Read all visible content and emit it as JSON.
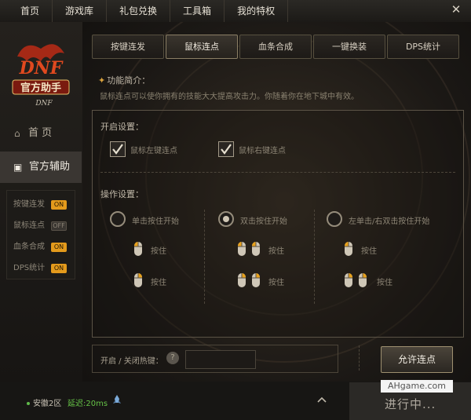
{
  "topnav": {
    "items": [
      {
        "label": "首页"
      },
      {
        "label": "游戏库"
      },
      {
        "label": "礼包兑换"
      },
      {
        "label": "工具箱"
      },
      {
        "label": "我的特权"
      }
    ],
    "close_icon": "close-icon"
  },
  "sidebar": {
    "logo_text": "官方助手",
    "logo_sub": "DNF",
    "home_label": "首 页",
    "official_label": "官方辅助",
    "subitems": [
      {
        "label": "按键连发",
        "state": "ON"
      },
      {
        "label": "鼠标连点",
        "state": "OFF"
      },
      {
        "label": "血条合成",
        "state": "ON"
      },
      {
        "label": "DPS统计",
        "state": "ON"
      }
    ]
  },
  "tabs": [
    {
      "label": "按键连发"
    },
    {
      "label": "鼠标连点"
    },
    {
      "label": "血条合成"
    },
    {
      "label": "一键换装"
    },
    {
      "label": "DPS统计"
    }
  ],
  "active_tab": "鼠标连点",
  "intro": {
    "title": "功能简介：",
    "text": "鼠标连点可以使你拥有的技能大大提高攻击力。你随着你在地下城中有效。"
  },
  "settings": {
    "open_label": "开启设置：",
    "left_click_label": "鼠标左键连点",
    "right_click_label": "鼠标右键连点",
    "left_checked": true,
    "right_checked": true,
    "op_label": "操作设置：",
    "modes": [
      {
        "label": "单击按住开始",
        "selected": false
      },
      {
        "label": "双击按住开始",
        "selected": true
      },
      {
        "label": "左单击/右双击按住开始",
        "selected": false
      }
    ],
    "press_label": "按住"
  },
  "hotkey": {
    "label": "开启 / 关闭热键：",
    "value": ""
  },
  "allow_button": "允许连点",
  "status": {
    "region": "安徽2区",
    "latency": "延迟:20ms",
    "running": "进行中...",
    "watermark": "AHgame.com"
  },
  "colors": {
    "accent": "#e39a1c",
    "latency_green": "#66c347"
  }
}
